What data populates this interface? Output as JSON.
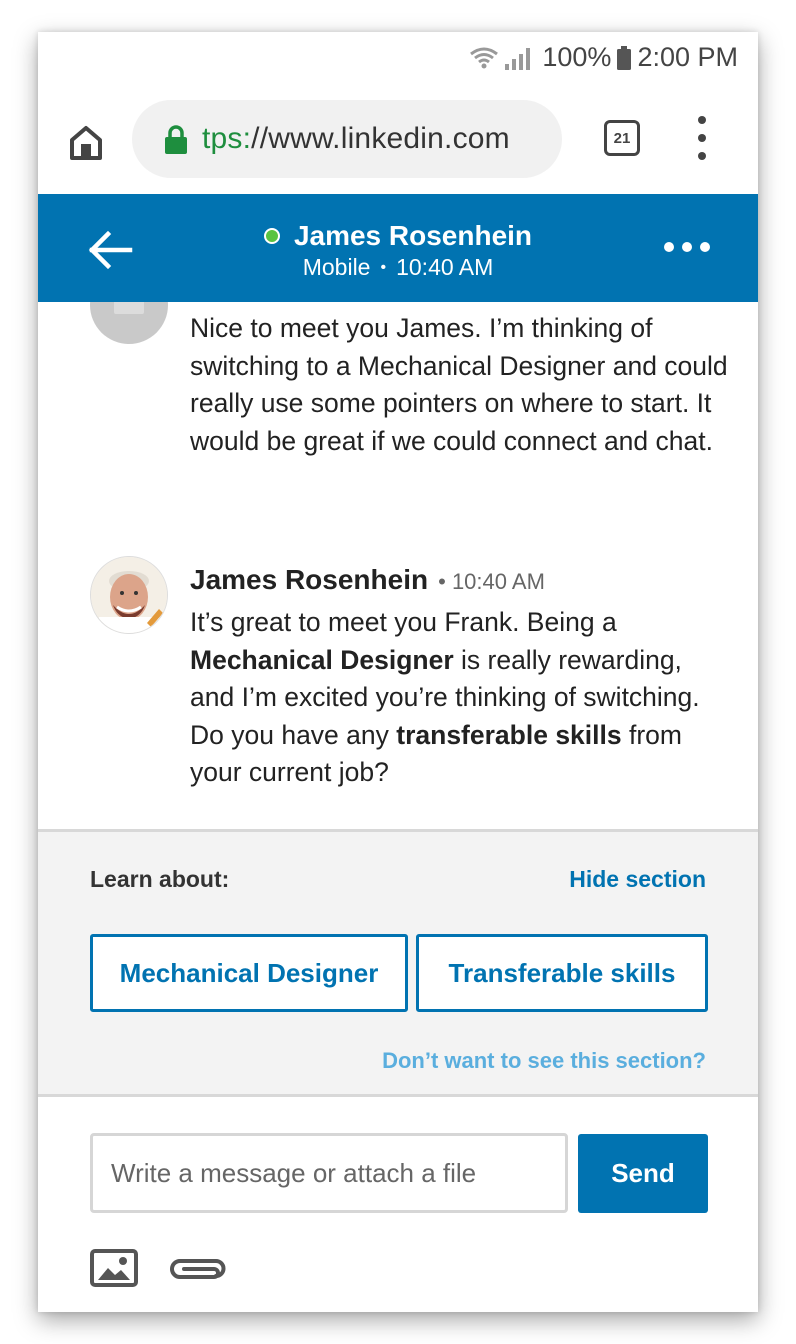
{
  "status_bar": {
    "battery": "100%",
    "time": "2:00 PM"
  },
  "browser": {
    "url_scheme": "tps:",
    "url_rest": "//www.linkedin.com",
    "tab_count": "21"
  },
  "header": {
    "name": "James Rosenhein",
    "device": "Mobile",
    "separator": "•",
    "time": "10:40 AM"
  },
  "messages": [
    {
      "text": "Nice to meet you James. I’m thinking of switching to a Mechanical Designer and could really use some pointers on where to start. It would be great if we could connect and chat."
    },
    {
      "sender": "James Rosenhein",
      "time_sep": "•",
      "time": "10:40 AM",
      "parts": [
        "It’s great to meet you Frank. Being a ",
        "Mechanical Designer",
        " is really rewarding, and I’m excited you’re thinking of switching. Do you have any ",
        "transferable skills",
        " from your current job?"
      ]
    }
  ],
  "learn": {
    "label": "Learn about:",
    "hide_link": "Hide section",
    "topics": [
      "Mechanical Designer",
      "Transferable skills"
    ],
    "dismiss_link": "Don’t want to see this section?"
  },
  "compose": {
    "placeholder": "Write a message or attach a file",
    "send_label": "Send"
  },
  "icons": [
    "wifi-icon",
    "signal-icon",
    "battery-icon",
    "home-icon",
    "lock-icon",
    "tabs-icon",
    "overflow-menu-icon",
    "back-arrow-icon",
    "online-status-icon",
    "more-options-icon",
    "photo-icon",
    "attachment-icon"
  ],
  "colors": {
    "brand_blue": "#0173b1",
    "online_green": "#5ac341",
    "link_light_blue": "#5aaede",
    "lock_green": "#1e8e3e"
  }
}
